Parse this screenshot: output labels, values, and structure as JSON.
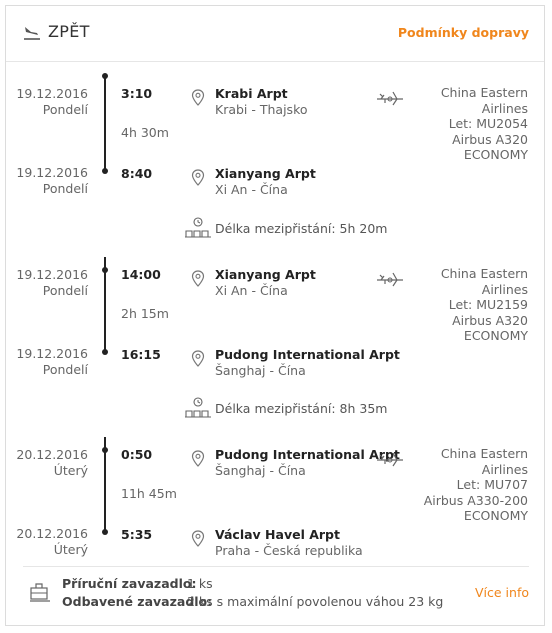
{
  "header": {
    "back_label": "ZPĚT",
    "conditions_link": "Podmínky dopravy"
  },
  "segments": [
    {
      "dep": {
        "date": "19.12.2016",
        "day": "Pondelí",
        "time": "3:10",
        "airport": "Krabi Arpt",
        "city": "Krabi - Thajsko"
      },
      "duration": "4h 30m",
      "arr": {
        "date": "19.12.2016",
        "day": "Pondelí",
        "time": "8:40",
        "airport": "Xianyang Arpt",
        "city": "Xi An - Čína"
      },
      "carrier": [
        "China Eastern",
        "Airlines",
        "Let: MU2054",
        "Airbus A320",
        "ECONOMY"
      ]
    },
    {
      "dep": {
        "date": "19.12.2016",
        "day": "Pondelí",
        "time": "14:00",
        "airport": "Xianyang Arpt",
        "city": "Xi An - Čína"
      },
      "duration": "2h 15m",
      "arr": {
        "date": "19.12.2016",
        "day": "Pondelí",
        "time": "16:15",
        "airport": "Pudong International Arpt",
        "city": "Šanghaj - Čína"
      },
      "carrier": [
        "China Eastern",
        "Airlines",
        "Let: MU2159",
        "Airbus A320",
        "ECONOMY"
      ]
    },
    {
      "dep": {
        "date": "20.12.2016",
        "day": "Úterý",
        "time": "0:50",
        "airport": "Pudong International Arpt",
        "city": "Šanghaj - Čína"
      },
      "duration": "11h 45m",
      "arr": {
        "date": "20.12.2016",
        "day": "Úterý",
        "time": "5:35",
        "airport": "Václav Havel Arpt",
        "city": "Praha - Česká republika"
      },
      "carrier": [
        "China Eastern",
        "Airlines",
        "Let: MU707",
        "Airbus A330-200",
        "ECONOMY"
      ]
    }
  ],
  "layovers": [
    "Délka mezipřistání: 5h 20m",
    "Délka mezipřistání: 8h 35m"
  ],
  "baggage": {
    "cabin_label": "Příruční zavazadlo:",
    "cabin_value": "1 ks",
    "checked_label": "Odbavené zavazadlo:",
    "checked_value": "2 ks s maximální povolenou váhou 23 kg",
    "more_info": "Více info"
  },
  "colors": {
    "accent": "#f0861c",
    "text": "#555555",
    "strong": "#222222"
  },
  "icons": [
    "plane-landing-icon",
    "location-pin-icon",
    "airplane-icon",
    "waiting-room-icon",
    "luggage-icon"
  ]
}
